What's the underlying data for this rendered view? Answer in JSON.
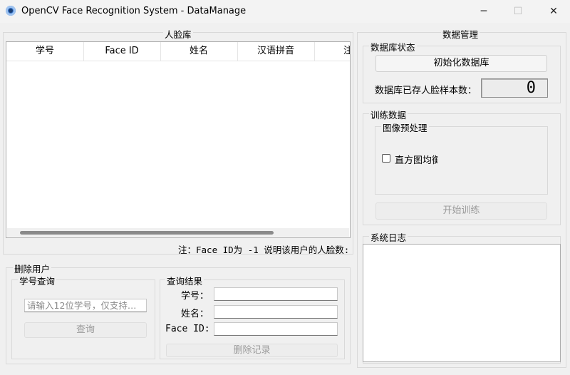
{
  "window": {
    "title": "OpenCV Face Recognition System - DataManage",
    "minimize": "─",
    "maximize": "☐",
    "close": "✕"
  },
  "face_db": {
    "title": "人脸库",
    "columns": [
      "学号",
      "Face ID",
      "姓名",
      "汉语拼音",
      "注册"
    ],
    "rows": [],
    "note": "注：Face ID为 -1 说明该用户的人脸数:"
  },
  "delete_user": {
    "title": "删除用户",
    "query_group": {
      "title": "学号查询",
      "placeholder": "请输入12位学号，仅支持…",
      "query_button": "查询"
    },
    "result_group": {
      "title": "查询结果",
      "student_id_label": "学号：",
      "name_label": "姓名：",
      "face_id_label": "Face ID:",
      "student_id_value": "",
      "name_value": "",
      "face_id_value": "",
      "delete_button": "删除记录"
    }
  },
  "data_mgmt": {
    "title": "数据管理",
    "db_status": {
      "title": "数据库状态",
      "init_button": "初始化数据库",
      "count_label": "数据库已存人脸样本数：",
      "count_value": "0"
    },
    "training": {
      "title": "训练数据",
      "preprocess_title": "图像预处理",
      "hist_eq_label": "直方图均衡",
      "hist_eq_checked": false,
      "start_button": "开始训练"
    },
    "log": {
      "title": "系统日志",
      "content": ""
    }
  },
  "icons": {
    "app": "webcam-icon",
    "minimize": "minimize-icon",
    "maximize": "maximize-icon",
    "close": "close-icon"
  }
}
